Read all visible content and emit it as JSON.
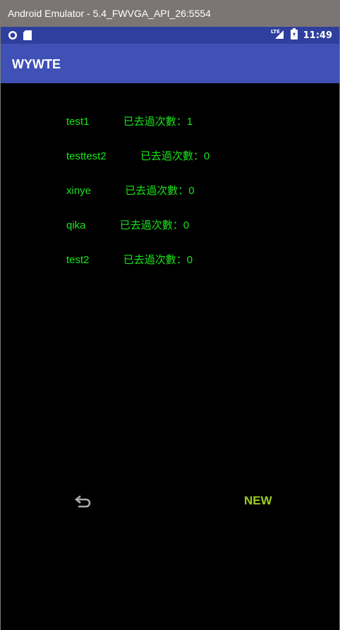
{
  "window": {
    "title": "Android Emulator - 5.4_FWVGA_API_26:5554"
  },
  "statusbar": {
    "time": "11:49",
    "network": "LTE"
  },
  "appbar": {
    "title": "WYWTE"
  },
  "rows": [
    {
      "name": "test1",
      "visits": "已去過次數：1"
    },
    {
      "name": "testtest2",
      "visits": "已去過次數：0"
    },
    {
      "name": "xinye",
      "visits": "已去過次數：0"
    },
    {
      "name": "qika",
      "visits": "已去過次數：0"
    },
    {
      "name": "test2",
      "visits": "已去過次數：0"
    }
  ],
  "actions": {
    "back_icon": "undo-arrow-icon",
    "new_label": "NEW"
  },
  "colors": {
    "titlebar": "#7b7674",
    "statusbar": "#2f3f9e",
    "appbar": "#3f51b5",
    "row_text": "#19e519",
    "new_button": "#9acd20"
  }
}
